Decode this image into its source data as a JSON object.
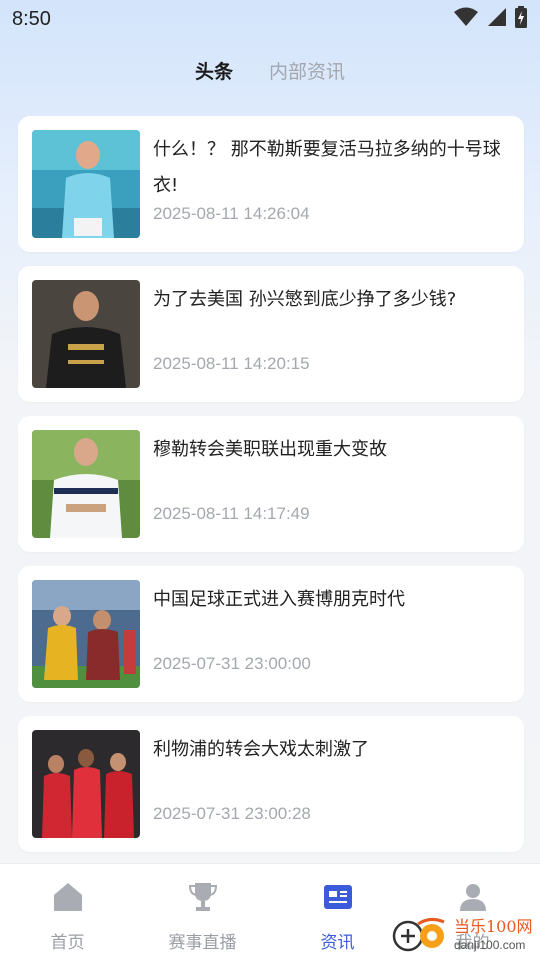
{
  "status_bar": {
    "time": "8:50",
    "icons": [
      "wifi-icon",
      "signal-icon",
      "battery-icon"
    ]
  },
  "tabs": [
    {
      "label": "头条",
      "active": true
    },
    {
      "label": "内部资讯",
      "active": false
    }
  ],
  "articles": [
    {
      "title": "什么！？ 那不勒斯要复活马拉多纳的十号球衣!",
      "time": "2025-08-11 14:26:04"
    },
    {
      "title": "为了去美国 孙兴慜到底少挣了多少钱?",
      "time": "2025-08-11 14:20:15"
    },
    {
      "title": "穆勒转会美职联出现重大变故",
      "time": "2025-08-11 14:17:49"
    },
    {
      "title": "中国足球正式进入赛博朋克时代",
      "time": "2025-07-31 23:00:00"
    },
    {
      "title": "利物浦的转会大戏太刺激了",
      "time": "2025-07-31 23:00:28"
    }
  ],
  "bottom_nav": [
    {
      "label": "首页",
      "icon": "home-icon",
      "active": false
    },
    {
      "label": "赛事直播",
      "icon": "trophy-icon",
      "active": false
    },
    {
      "label": "资讯",
      "icon": "news-icon",
      "active": true
    },
    {
      "label": "我的",
      "icon": "person-icon",
      "active": false
    }
  ],
  "watermark": {
    "text_cn": "当乐100网",
    "url": "danji100.com"
  },
  "colors": {
    "accent": "#3b5bdb",
    "inactive": "#9a9ea5",
    "time_text": "#a4a8ae"
  }
}
